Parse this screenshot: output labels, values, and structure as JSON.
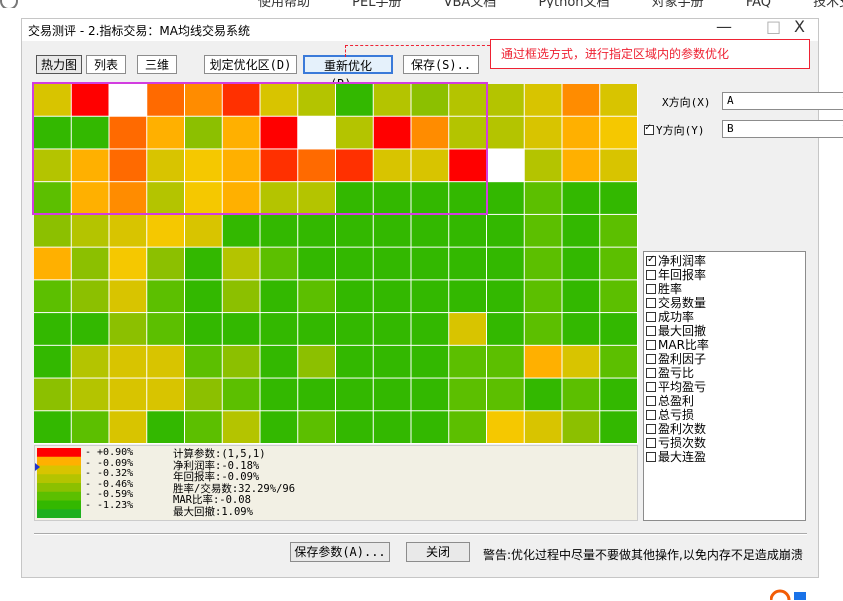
{
  "topbar": {
    "nav": [
      "使用帮助",
      "PEL手册",
      "VBA文档",
      "Python文档",
      "对象手册",
      "FAQ",
      "技术支持"
    ]
  },
  "window": {
    "title": "交易测评 - 2.指标交易：MA均线交易系统",
    "minimize": "—",
    "maximize": "□",
    "close": "X"
  },
  "toolbar": {
    "tabs": [
      {
        "label": "热力图",
        "selected": true
      },
      {
        "label": "列表",
        "selected": false
      },
      {
        "label": "三维",
        "selected": false
      }
    ],
    "define_zone_label": "划定优化区(D)",
    "reoptimize_label": "重新优化(R)..",
    "save_label": "保存(S).."
  },
  "callout": {
    "text": "通过框选方式，进行指定区域内的参数优化"
  },
  "axes": {
    "x_label": "X方向(X)",
    "x_value": "A",
    "y_label": "Y方向(Y)",
    "y_value": "B",
    "y_checked": true
  },
  "metrics": [
    {
      "label": "净利润率",
      "checked": true
    },
    {
      "label": "年回报率",
      "checked": false
    },
    {
      "label": "胜率",
      "checked": false
    },
    {
      "label": "交易数量",
      "checked": false
    },
    {
      "label": "成功率",
      "checked": false
    },
    {
      "label": "最大回撤",
      "checked": false
    },
    {
      "label": "MAR比率",
      "checked": false
    },
    {
      "label": "盈利因子",
      "checked": false
    },
    {
      "label": "盈亏比",
      "checked": false
    },
    {
      "label": "平均盈亏",
      "checked": false
    },
    {
      "label": "总盈利",
      "checked": false
    },
    {
      "label": "总亏损",
      "checked": false
    },
    {
      "label": "盈利次数",
      "checked": false
    },
    {
      "label": "亏损次数",
      "checked": false
    },
    {
      "label": "最大连盈",
      "checked": false
    }
  ],
  "heatmap": {
    "colors": {
      "W": "#ffffff",
      "R": "#ff0000",
      "R2": "#ff3000",
      "O": "#ff6a00",
      "O2": "#ff8c00",
      "Y": "#ffb000",
      "Y2": "#f5c800",
      "L": "#d8c400",
      "LG": "#b4c400",
      "G1": "#8cc000",
      "G2": "#5cbf00",
      "G3": "#33b800",
      "G4": "#1eb01e"
    },
    "rows": [
      [
        "L",
        "R",
        "W",
        "O",
        "O2",
        "R2",
        "L",
        "LG",
        "G3",
        "LG",
        "G1",
        "LG",
        "LG",
        "L",
        "O2",
        "L"
      ],
      [
        "G3",
        "G3",
        "O",
        "Y",
        "G1",
        "Y",
        "R",
        "W",
        "LG",
        "R",
        "O2",
        "LG",
        "LG",
        "L",
        "Y",
        "Y2"
      ],
      [
        "LG",
        "Y",
        "O",
        "L",
        "Y2",
        "Y",
        "R2",
        "O",
        "R2",
        "L",
        "L",
        "R",
        "W",
        "LG",
        "Y",
        "L"
      ],
      [
        "G2",
        "Y",
        "O2",
        "LG",
        "Y2",
        "Y",
        "LG",
        "LG",
        "G3",
        "G3",
        "G3",
        "G3",
        "G3",
        "G2",
        "G3",
        "G3"
      ],
      [
        "G1",
        "LG",
        "L",
        "Y2",
        "L",
        "G3",
        "G3",
        "G3",
        "G3",
        "G3",
        "G3",
        "G3",
        "G3",
        "G2",
        "G3",
        "G2"
      ],
      [
        "Y",
        "G1",
        "Y2",
        "G1",
        "G3",
        "LG",
        "G2",
        "G3",
        "G3",
        "G3",
        "G3",
        "G3",
        "G3",
        "G2",
        "G3",
        "G2"
      ],
      [
        "G2",
        "G1",
        "L",
        "G2",
        "G3",
        "G1",
        "G3",
        "G2",
        "G3",
        "G3",
        "G3",
        "G3",
        "G3",
        "G2",
        "G3",
        "G2"
      ],
      [
        "G3",
        "G3",
        "G1",
        "G2",
        "G3",
        "G3",
        "G3",
        "G3",
        "G3",
        "G3",
        "G3",
        "L",
        "G3",
        "G2",
        "G3",
        "G3"
      ],
      [
        "G3",
        "LG",
        "L",
        "L",
        "G2",
        "G1",
        "G3",
        "G1",
        "G3",
        "G3",
        "G3",
        "G2",
        "G2",
        "Y",
        "L",
        "G2"
      ],
      [
        "G1",
        "LG",
        "L",
        "L",
        "G1",
        "G2",
        "G3",
        "G3",
        "G3",
        "G3",
        "G3",
        "G2",
        "G2",
        "G3",
        "G2",
        "G3"
      ],
      [
        "G3",
        "G2",
        "L",
        "G3",
        "G2",
        "LG",
        "G3",
        "G2",
        "G3",
        "G3",
        "G3",
        "G2",
        "Y2",
        "L",
        "G1",
        "G3"
      ]
    ]
  },
  "legend": {
    "gradient": [
      "#ff0000",
      "#ffb000",
      "#d8c400",
      "#b4c400",
      "#8cc000",
      "#5cbf00",
      "#33b800",
      "#1eb01e"
    ],
    "ticks": [
      "+0.90%",
      "-0.09%",
      "-0.32%",
      "-0.46%",
      "-0.59%",
      "-1.23%"
    ],
    "info": [
      "计算参数:(1,5,1)",
      "净利润率:-0.18%",
      "年回报率:-0.09%",
      "胜率/交易数:32.29%/96",
      "MAR比率:-0.08",
      "最大回撤:1.09%"
    ]
  },
  "bottom": {
    "save_params_label": "保存参数(A)...",
    "close_label": "关闭",
    "warning": "警告:优化过程中尽量不要做其他操作,以免内存不足造成崩溃"
  }
}
